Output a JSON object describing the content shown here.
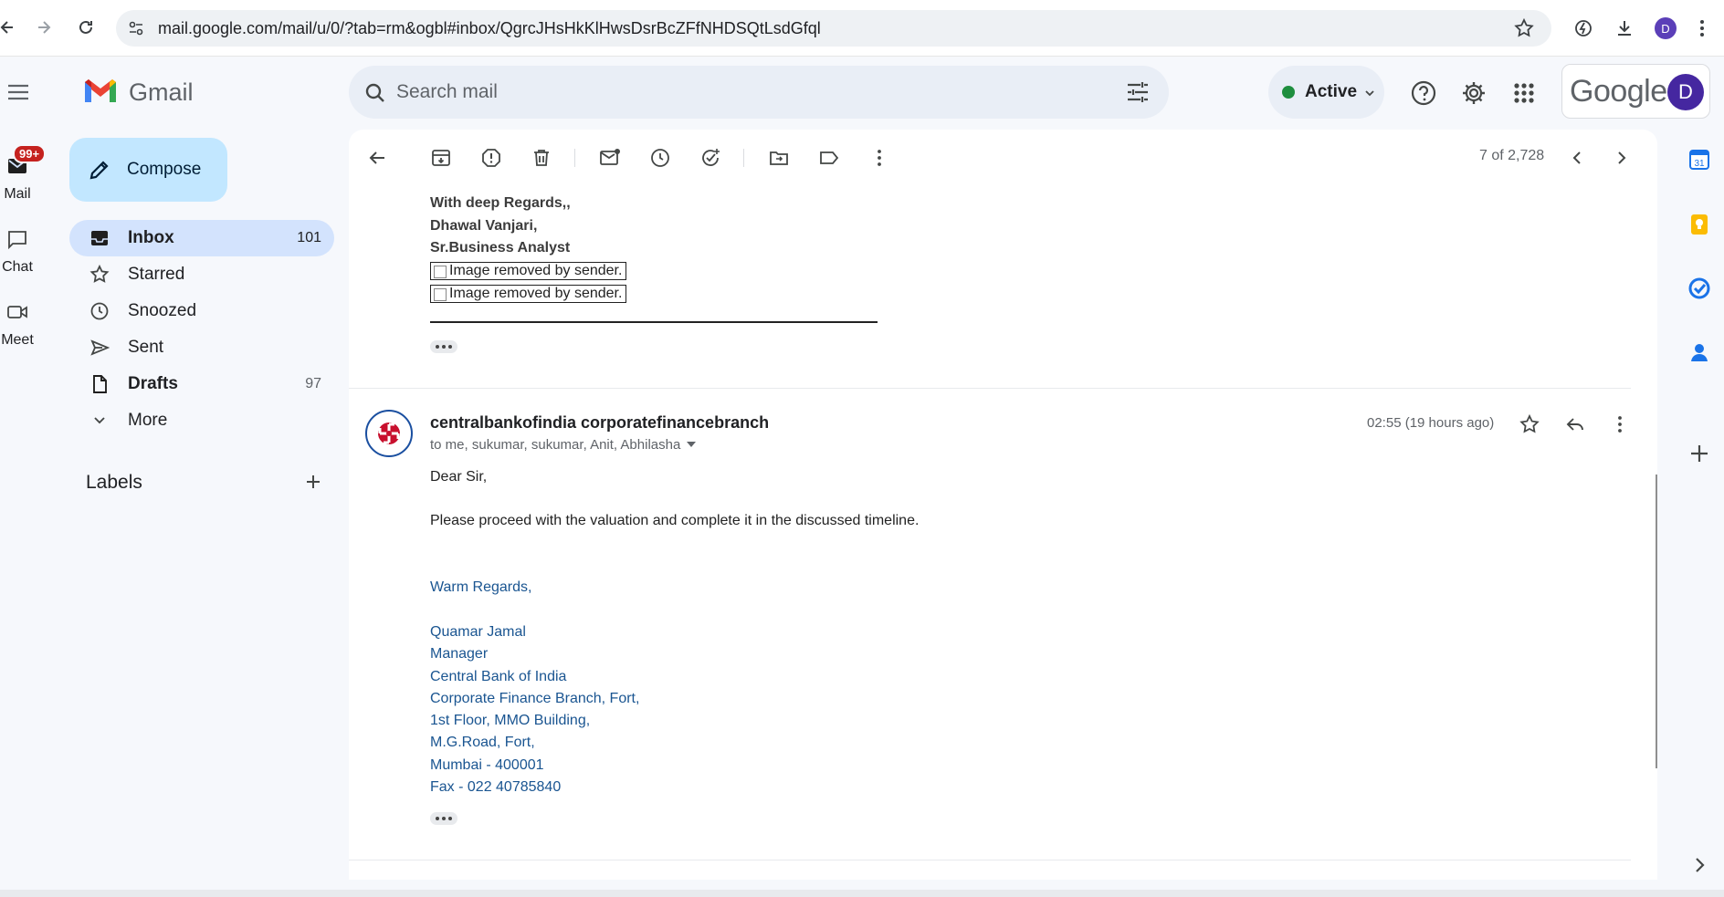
{
  "browser": {
    "url": "mail.google.com/mail/u/0/?tab=rm&ogbl#inbox/QgrcJHsHkKlHwsDsrBcZFfNHDSQtLsdGfql",
    "profile_initial": "D"
  },
  "header": {
    "app_name": "Gmail",
    "search_placeholder": "Search mail",
    "status_label": "Active",
    "google_label": "Google",
    "account_initial": "D"
  },
  "rail": {
    "mail_label": "Mail",
    "mail_badge": "99+",
    "chat_label": "Chat",
    "meet_label": "Meet"
  },
  "sidebar": {
    "compose_label": "Compose",
    "items": [
      {
        "label": "Inbox",
        "count": "101"
      },
      {
        "label": "Starred",
        "count": ""
      },
      {
        "label": "Snoozed",
        "count": ""
      },
      {
        "label": "Sent",
        "count": ""
      },
      {
        "label": "Drafts",
        "count": "97"
      },
      {
        "label": "More",
        "count": ""
      }
    ],
    "labels_heading": "Labels"
  },
  "toolbar": {
    "pager_text": "7 of 2,728"
  },
  "previous_message": {
    "signature_lines": [
      "With deep Regards,,",
      "Dhawal Vanjari,",
      "Sr.Business Analyst"
    ],
    "image_placeholder_1": "Image removed by sender.",
    "image_placeholder_2": "Image removed by sender."
  },
  "message": {
    "sender": "centralbankofindia corporatefinancebranch",
    "recipients": "to me, sukumar, sukumar, Anit, Abhilasha",
    "timestamp": "02:55 (19 hours ago)",
    "greeting": "Dear Sir,",
    "body": "Please proceed with the valuation and complete it in the discussed timeline.",
    "closing": "Warm Regards,",
    "signature_lines": [
      "Quamar Jamal",
      "Manager",
      "Central Bank of India",
      "Corporate Finance Branch, Fort,",
      "1st Floor, MMO Building,",
      "M.G.Road, Fort,",
      "Mumbai - 400001",
      "Fax - 022 40785840"
    ]
  },
  "colors": {
    "compose_bg": "#c2e7ff",
    "inbox_selected_bg": "#d3e3fd",
    "active_dot": "#1e8e3e",
    "signature_blue": "#1a5591",
    "badge_red": "#c5221f"
  }
}
